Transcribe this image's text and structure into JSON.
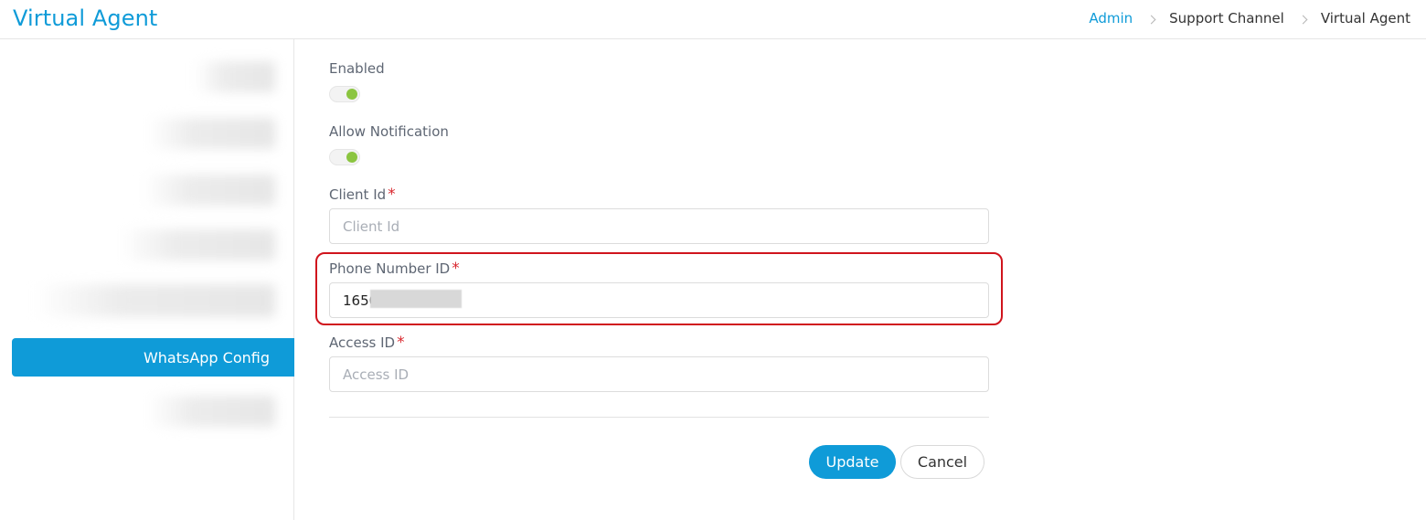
{
  "header": {
    "title": "Virtual Agent",
    "breadcrumb": [
      "Admin",
      "Support Channel",
      "Virtual Agent"
    ]
  },
  "sidebar": {
    "items": [
      {
        "label": "",
        "blurred": true
      },
      {
        "label": "",
        "blurred": true
      },
      {
        "label": "",
        "blurred": true
      },
      {
        "label": "",
        "blurred": true
      },
      {
        "label": "",
        "blurred": true
      },
      {
        "label": "WhatsApp Config",
        "active": true
      },
      {
        "label": "",
        "blurred": true
      }
    ]
  },
  "form": {
    "enabled_label": "Enabled",
    "enabled_on": true,
    "allow_notification_label": "Allow Notification",
    "allow_notification_on": true,
    "client_id": {
      "label": "Client Id",
      "required_mark": "*",
      "placeholder": "Client Id",
      "value": ""
    },
    "phone_number_id": {
      "label": "Phone Number ID",
      "required_mark": "*",
      "value": "1650          0965"
    },
    "access_id": {
      "label": "Access ID",
      "required_mark": "*",
      "placeholder": "Access ID",
      "value": ""
    }
  },
  "actions": {
    "update_label": "Update",
    "cancel_label": "Cancel"
  },
  "colors": {
    "accent": "#0f9bd8",
    "toggle_on": "#8bc540",
    "required": "#d9272e",
    "highlight": "#d0141d"
  }
}
